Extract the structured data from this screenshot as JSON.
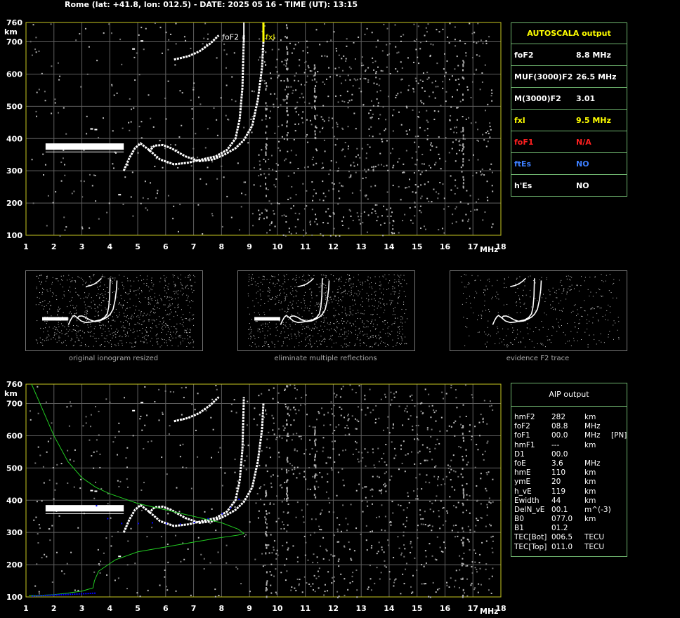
{
  "header": "Rome (lat: +41.8, lon: 012.5) - DATE: 2025 05 16 - TIME (UT): 13:15",
  "colors": {
    "grid": "#606060",
    "frame": "#c8c820",
    "panel_border": "#6fb56f",
    "fof2_mark": "#ffffff",
    "fxl_mark": "#ffff00",
    "profile": "#22cc22",
    "aip_points": "#0000ff",
    "na_red": "#ff2020",
    "no_blue": "#3d7fff",
    "fxl_text": "#ffff00"
  },
  "axis": {
    "km_label": "km",
    "mhz_label": "MHz",
    "xmin": 1,
    "xmax": 18,
    "ymin": 100,
    "ymax": 760,
    "x_ticks": [
      "1",
      "2",
      "3",
      "4",
      "5",
      "6",
      "7",
      "8",
      "9",
      "10",
      "11",
      "12",
      "13",
      "14",
      "15",
      "16",
      "17",
      "18"
    ],
    "y_ticks": [
      {
        "v": 100,
        "t": "100"
      },
      {
        "v": 200,
        "t": "200"
      },
      {
        "v": 300,
        "t": "300"
      },
      {
        "v": 400,
        "t": "400"
      },
      {
        "v": 500,
        "t": "500"
      },
      {
        "v": 600,
        "t": "600"
      },
      {
        "v": 700,
        "t": "700"
      },
      {
        "v": 760,
        "t": "760"
      }
    ]
  },
  "chart_data": {
    "type": "scatter",
    "title": "",
    "xlabel": "MHz",
    "ylabel": "km",
    "xlim": [
      1,
      18
    ],
    "ylim": [
      100,
      760
    ],
    "markers": [
      {
        "label": "foF2",
        "x": 8.8
      },
      {
        "label": "fxl",
        "x": 9.5
      }
    ],
    "series": [
      {
        "name": "",
        "kind": "echo_band",
        "x": [
          1.7,
          4.5
        ],
        "y": [
          365,
          385
        ]
      },
      {
        "name": "",
        "kind": "o_trace",
        "x": [
          4.5,
          4.7,
          4.9,
          5.1,
          5.4,
          5.8,
          6.3,
          6.8,
          7.3,
          7.8,
          8.2,
          8.5,
          8.65,
          8.75,
          8.8
        ],
        "y": [
          300,
          340,
          370,
          385,
          365,
          335,
          320,
          325,
          335,
          345,
          365,
          400,
          460,
          560,
          720
        ]
      },
      {
        "name": "",
        "kind": "x_trace",
        "x": [
          5.4,
          5.6,
          5.9,
          6.2,
          6.7,
          7.2,
          7.7,
          8.1,
          8.5,
          8.8,
          9.1,
          9.3,
          9.45,
          9.5
        ],
        "y": [
          360,
          378,
          380,
          370,
          345,
          330,
          335,
          350,
          370,
          395,
          440,
          520,
          620,
          700
        ]
      },
      {
        "name": "",
        "kind": "upper_trace",
        "x": [
          6.3,
          6.8,
          7.2,
          7.6,
          7.9
        ],
        "y": [
          645,
          655,
          670,
          695,
          720
        ]
      },
      {
        "name": "",
        "kind": "aip_profile",
        "x": [
          1.1,
          1.5,
          2.0,
          2.5,
          3.0,
          3.4,
          3.45,
          3.6,
          4.2,
          5.0,
          6.0,
          7.0,
          7.8,
          8.3,
          8.6,
          8.8,
          8.6,
          8.0,
          7.0,
          6.0,
          5.0,
          4.0,
          3.5,
          3.0,
          2.5,
          2.0,
          1.6,
          1.2
        ],
        "y": [
          105,
          105,
          107,
          112,
          118,
          128,
          150,
          180,
          215,
          240,
          255,
          270,
          282,
          288,
          292,
          297,
          310,
          330,
          350,
          370,
          390,
          420,
          440,
          470,
          520,
          600,
          680,
          760
        ]
      },
      {
        "name": "",
        "kind": "aip_points",
        "x": [
          3.5,
          3.9,
          4.4,
          5.0,
          5.5,
          6.0,
          6.5,
          7.0,
          7.5,
          8.0,
          8.3,
          8.6
        ],
        "y": [
          385,
          345,
          330,
          330,
          332,
          330,
          328,
          333,
          345,
          360,
          378,
          405
        ]
      }
    ]
  },
  "thumbs": [
    {
      "caption": "original ionogram resized"
    },
    {
      "caption": "eliminate multiple reflections"
    },
    {
      "caption": "evidence F2 trace"
    }
  ],
  "autoscala": {
    "title": "AUTOSCALA output",
    "rows": [
      {
        "k": "foF2",
        "v": "8.8 MHz",
        "c": "#ffffff"
      },
      {
        "k": "MUF(3000)F2",
        "v": "26.5 MHz",
        "c": "#ffffff"
      },
      {
        "k": "M(3000)F2",
        "v": "3.01",
        "c": "#ffffff"
      },
      {
        "k": "fxl",
        "v": "9.5 MHz",
        "c": "#ffff00"
      },
      {
        "k": "foF1",
        "v": "N/A",
        "c": "#ff2020"
      },
      {
        "k": "ftEs",
        "v": "NO",
        "c": "#3d7fff"
      },
      {
        "k": "h'Es",
        "v": "NO",
        "c": "#ffffff"
      }
    ]
  },
  "aip": {
    "title": "AIP output",
    "rows": [
      [
        "hmF2",
        "282",
        "km",
        ""
      ],
      [
        "foF2",
        "08.8",
        "MHz",
        ""
      ],
      [
        "foF1",
        "00.0",
        "MHz",
        "[PN]"
      ],
      [
        "hmF1",
        "---",
        "km",
        ""
      ],
      [
        "D1",
        "00.0",
        "",
        ""
      ],
      [
        "foE",
        "3.6",
        "MHz",
        ""
      ],
      [
        "hmE",
        "110",
        "km",
        ""
      ],
      [
        "ymE",
        "20",
        "km",
        ""
      ],
      [
        "h_vE",
        "119",
        "km",
        ""
      ],
      [
        "Ewidth",
        "44",
        "km",
        ""
      ],
      [
        "DelN_vE",
        "00.1",
        "m^(-3)",
        ""
      ],
      [
        "B0",
        "077.0",
        "km",
        ""
      ],
      [
        "B1",
        "01.2",
        "",
        ""
      ],
      [
        "TEC[Bot]",
        "006.5",
        "TECU",
        ""
      ],
      [
        "TEC[Top]",
        "011.0",
        "TECU",
        ""
      ]
    ]
  }
}
